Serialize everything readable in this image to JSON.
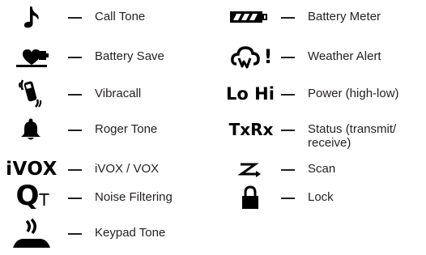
{
  "legend": {
    "left": [
      {
        "icon": "music-note-icon",
        "label": "Call Tone"
      },
      {
        "icon": "heart-battery-icon",
        "label": "Battery Save"
      },
      {
        "icon": "vibrating-phone-icon",
        "label": "Vibracall"
      },
      {
        "icon": "bell-icon",
        "label": "Roger Tone"
      },
      {
        "icon": "ivox-text-icon",
        "icon_text": "iVOX",
        "label": "iVOX / VOX"
      },
      {
        "icon": "noise-filter-icon",
        "icon_text": "Q",
        "icon_sub": "T",
        "label": "Noise Filtering"
      },
      {
        "icon": "keypad-tone-icon",
        "label": "Keypad Tone"
      }
    ],
    "right": [
      {
        "icon": "battery-icon",
        "label": "Battery Meter"
      },
      {
        "icon": "weather-alert-icon",
        "icon_text": "!",
        "label": "Weather Alert"
      },
      {
        "icon": "lo-hi-text-icon",
        "icon_text": "Lo Hi",
        "label": "Power (high-low)"
      },
      {
        "icon": "txrx-text-icon",
        "icon_text": "TxRx",
        "label_line1": "Status (transmit/",
        "label_line2": "receive)"
      },
      {
        "icon": "scan-icon",
        "label": "Scan"
      },
      {
        "icon": "lock-icon",
        "label": "Lock"
      }
    ]
  }
}
